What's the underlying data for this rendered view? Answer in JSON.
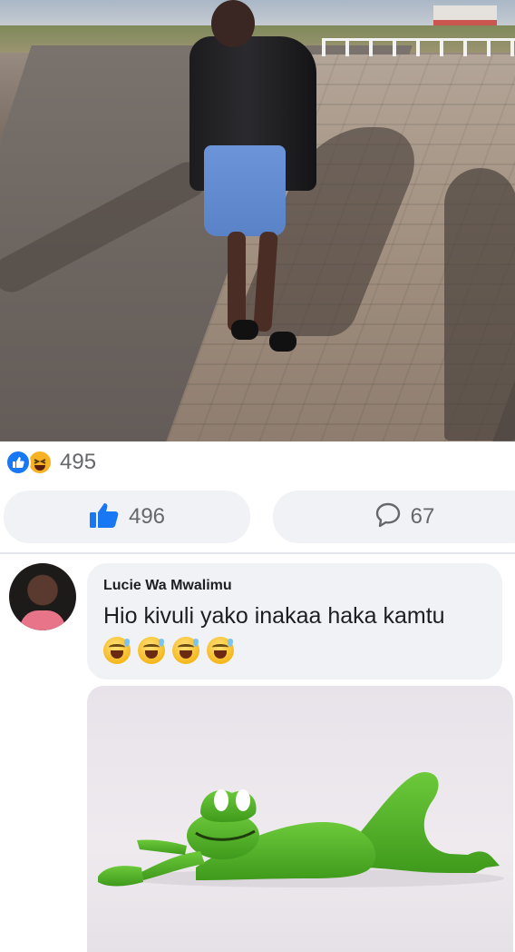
{
  "post": {
    "photo_description_icon": "photo-woman-walkway-shadows"
  },
  "reactions": {
    "icons": [
      "like-icon",
      "haha-icon"
    ],
    "count": "495"
  },
  "actions": {
    "like_count": "496",
    "comment_count": "67"
  },
  "comment": {
    "author": "Lucie Wa Mwalimu",
    "text": "Hio kivuli yako inakaa haka kamtu",
    "emojis": [
      "grinning-sweat-emoji",
      "grinning-sweat-emoji",
      "grinning-sweat-emoji",
      "grinning-sweat-emoji"
    ],
    "attachment_icon": "kermit-lying-image"
  },
  "colors": {
    "facebook_blue": "#1877f2",
    "haha_yellow": "#f7b125",
    "bubble_gray": "#f0f2f5",
    "kermit_green": "#5fb82c"
  }
}
